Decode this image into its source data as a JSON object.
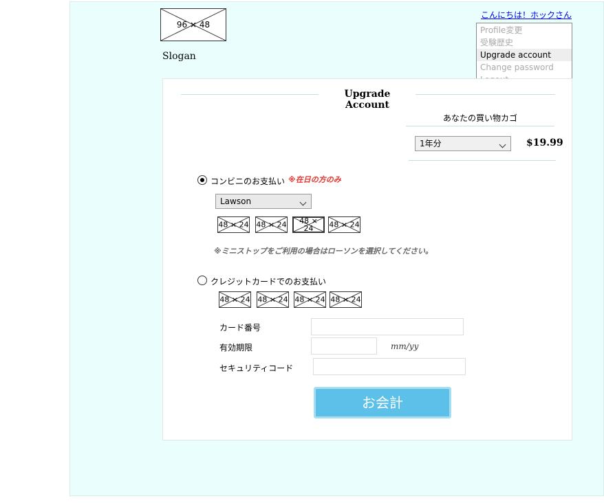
{
  "header": {
    "logo_text": "96 × 48",
    "slogan": "Slogan",
    "greeting_link": "こんにちは！ホックさん"
  },
  "user_menu": {
    "items": [
      {
        "label": "Profile変更",
        "active": false
      },
      {
        "label": "受験歴史",
        "active": false
      },
      {
        "label": "Upgrade account",
        "active": true
      },
      {
        "label": "Change password",
        "active": false
      },
      {
        "label": "Logout",
        "active": false
      }
    ]
  },
  "upgrade": {
    "title": "Upgrade Account",
    "cart_title": "あなたの買い物カゴ",
    "plan_select_value": "1年分",
    "price": "$19.99"
  },
  "payment": {
    "convenience": {
      "label": "コンビニのお支払い",
      "note": "※在日の方のみ",
      "selected": true,
      "store_select_value": "Lawson",
      "store_logos": [
        "48 × 24",
        "48 × 24",
        "48 × 24",
        "48 × 24"
      ],
      "ministop_note": "※ミニストップをご利用の場合はローソンを選択してください。"
    },
    "credit": {
      "label": "クレジットカードでのお支払い",
      "selected": false,
      "card_logos": [
        "48 × 24",
        "48 × 24",
        "48 × 24",
        "48 × 24"
      ],
      "card_number_label": "カード番号",
      "card_number_value": "",
      "expiry_label": "有効期限",
      "expiry_value": "",
      "expiry_hint": "mm/yy",
      "security_code_label": "セキュリティコード",
      "security_code_value": ""
    },
    "checkout_label": "お会計"
  },
  "colors": {
    "page_background": "#eafffd",
    "checkout_button": "#5cc0e8",
    "note_red": "#e5322d",
    "link": "#0000ee"
  }
}
